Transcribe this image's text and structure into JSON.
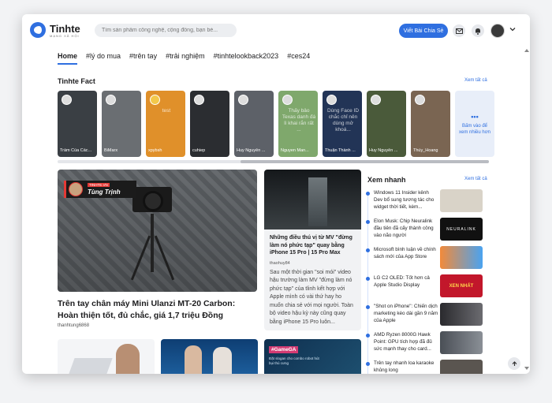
{
  "header": {
    "brand": "Tinhte",
    "brand_sub": "MẠNG XÃ HỘI",
    "search_placeholder": "Tìm sản phẩm công nghệ, cộng đồng, bạn bè...",
    "cta_label": "Viết Bài Chia Sẻ",
    "icons": [
      "mail-icon",
      "bell-icon",
      "avatar",
      "chevron-down-icon"
    ]
  },
  "tabs": [
    {
      "label": "Home",
      "active": true
    },
    {
      "label": "#lý do mua"
    },
    {
      "label": "#trên tay"
    },
    {
      "label": "#trải nghiệm"
    },
    {
      "label": "#tinhtelookback2023"
    },
    {
      "label": "#ces24"
    }
  ],
  "facts": {
    "title": "Tinhte Fact",
    "see_all": "Xem tất cả",
    "items": [
      {
        "name": "Trầm Của Các...",
        "text": "",
        "color": "#3a3f44"
      },
      {
        "name": "BiMarx",
        "text": "",
        "color": "#6a6e72"
      },
      {
        "name": "xpybsh",
        "text": "test",
        "color": "#e0902a"
      },
      {
        "name": "cuhiep",
        "text": "",
        "color": "#2b2d31"
      },
      {
        "name": "Huy Nguyễn ...",
        "text": "",
        "color": "#5d6168"
      },
      {
        "name": "Nguyen Man...",
        "text": "Thấy bảo Texas danh đá lì khai rắn rất ...",
        "color": "#7fa86c"
      },
      {
        "name": "Thuận Thành ...",
        "text": "Dùng Face ID chắc chỉ nên dùng mở khoá...",
        "color": "#223456"
      },
      {
        "name": "Huy Nguyễn ...",
        "text": "",
        "color": "#4a5a3a"
      },
      {
        "name": "Thủy_Hoang",
        "text": "",
        "color": "#7a6552"
      }
    ],
    "more_dots": "•••",
    "more_label": "Bấm vào để xem nhiều hơn"
  },
  "main_article": {
    "badge_kicker": "TINHTE.VN",
    "badge_name": "Tùng Trịnh",
    "title": "Trên tay chân máy Mini Ulanzi MT-20 Carbon: Hoàn thiện tốt, đủ chắc, giá 1,7 triệu Đồng",
    "author": "thanhtung6868"
  },
  "mid_article": {
    "title": "Những điều thú vị từ MV \"đừng làm nó phức tạp\" quay bằng iPhone 15 Pro | 15 Pro Max",
    "author": "thaohuy84",
    "desc": "Sau một thời gian \"soi mói\" video hậu trường làm MV \"đừng làm nó phức tạp\" của tlinh kết hợp với Apple mình có vài thứ hay ho muốn chia sẻ với mọi người. Toàn bộ video hậu kỳ này cũng quay bằng iPhone 15 Pro luôn..."
  },
  "quick": {
    "title": "Xem nhanh",
    "see_all": "Xem tất cả",
    "items": [
      {
        "text": "Windows 11 Insider kênh Dev bổ sung tương tác cho widget thời tiết, kèm...",
        "thumb": "#d9d3c8"
      },
      {
        "text": "Elon Musk: Chip Neuralink đầu tiên đã cấy thành công vào não người",
        "thumb": "#111111",
        "thumb_text": "NEURALINK"
      },
      {
        "text": "Microsoft bình luận về chính sách mới của App Store",
        "thumb": "#f28a3a"
      },
      {
        "text": "LG C2 OLED: Tốt hơn cả Apple Studio Display",
        "thumb": "#c2172b",
        "thumb_text": "XEN NHẤT"
      },
      {
        "text": "\"Shot on iPhone\": Chiến dịch marketing kéo dài gần 9 năm của Apple",
        "thumb": "#3b3b3f"
      },
      {
        "text": "AMD Ryzen 8000G Hawk Point: GPU tích hợp đã đủ sức mạnh thay cho card...",
        "thumb": "#4a4f56"
      },
      {
        "text": "Trên tay nhanh loa karaoke khủng long",
        "thumb": "#5a5550"
      }
    ]
  },
  "bottom": {
    "gamega_tag": "#GameGA",
    "gamega_sub": "Đặt slogan cho combo robot hút bụi thú cưng"
  }
}
